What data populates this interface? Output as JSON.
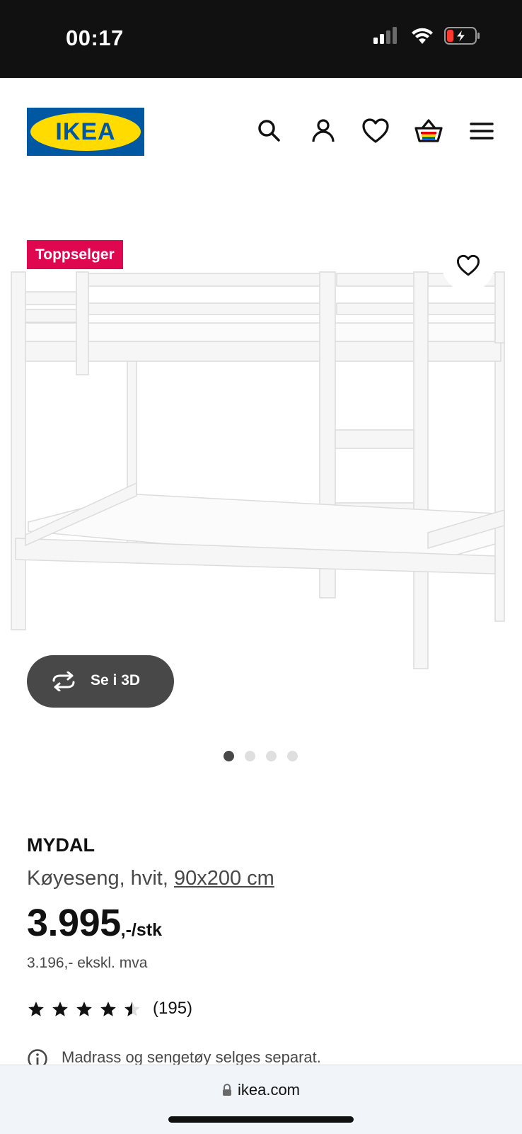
{
  "status_bar": {
    "time": "00:17"
  },
  "header": {
    "logo_text": "IKEA",
    "icons": [
      "search-icon",
      "account-icon",
      "heart-icon",
      "basket-icon",
      "menu-icon"
    ]
  },
  "product_image": {
    "badge": "Toppselger",
    "view3d_label": "Se i 3D",
    "carousel_count": 4,
    "carousel_active": 1
  },
  "product": {
    "name": "MYDAL",
    "description": "Køyeseng, hvit,",
    "size_link": "90x200 cm",
    "price_integer": "3.995",
    "price_suffix": ",-/stk",
    "price_excl_vat": "3.196,- ekskl. mva",
    "rating_value": 4.5,
    "rating_count": "(195)",
    "notice": "Madrass og sengetøy selges separat."
  },
  "browser": {
    "url": "ikea.com"
  },
  "colors": {
    "ikea_blue": "#0058a3",
    "ikea_yellow": "#ffdb00",
    "badge_red": "#e00751",
    "button_dark": "#484848"
  }
}
